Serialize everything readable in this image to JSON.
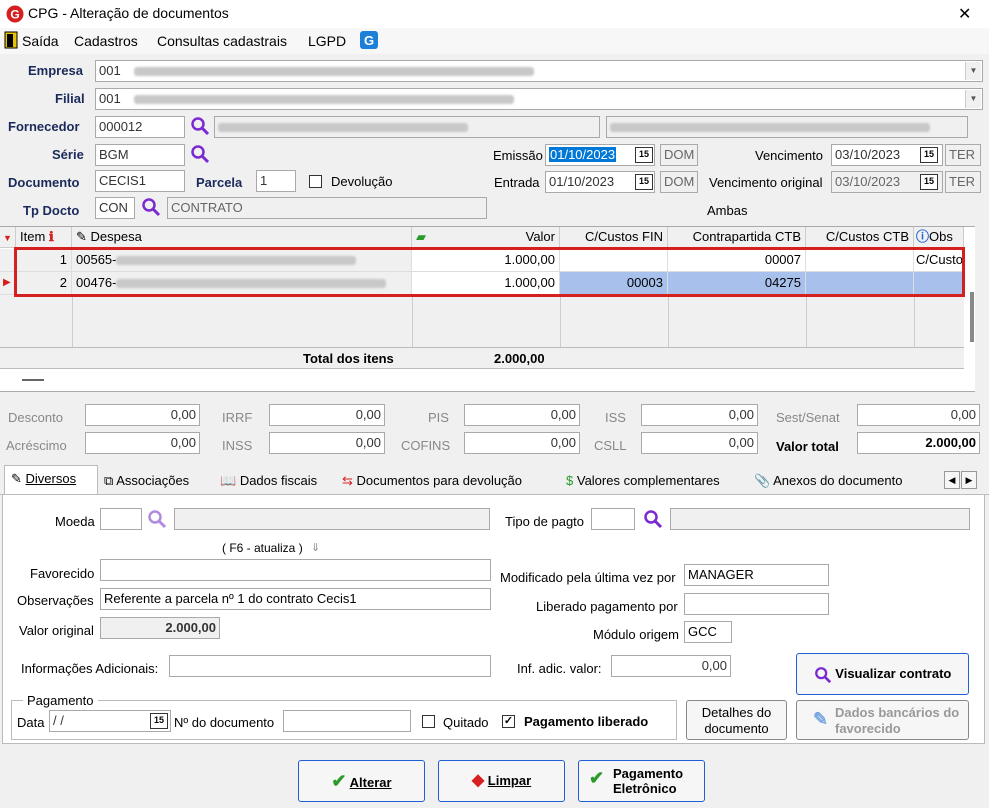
{
  "window": {
    "title": "CPG - Alteração de documentos",
    "close_glyph": "✕"
  },
  "menu": [
    "Saída",
    "Cadastros",
    "Consultas cadastrais",
    "LGPD"
  ],
  "header": {
    "empresa_label": "Empresa",
    "empresa_value": "001",
    "filial_label": "Filial",
    "filial_value": "001",
    "fornecedor_label": "Fornecedor",
    "fornecedor_value": "000012",
    "serie_label": "Série",
    "serie_value": "BGM",
    "documento_label": "Documento",
    "documento_value": "CECIS1",
    "parcela_label": "Parcela",
    "parcela_value": "1",
    "devolucao_label": "Devolução",
    "tpdocto_label": "Tp Docto",
    "tpdocto_value": "CON",
    "tpdocto_desc": "CONTRATO",
    "emissao_label": "Emissão",
    "emissao_value": "01/10/2023",
    "emissao_day": "DOM",
    "entrada_label": "Entrada",
    "entrada_value": "01/10/2023",
    "entrada_day": "DOM",
    "vencimento_label": "Vencimento",
    "vencimento_value": "03/10/2023",
    "vencimento_day": "TER",
    "vencorig_label": "Vencimento original",
    "vencorig_value": "03/10/2023",
    "vencorig_day": "TER",
    "ambas": "Ambas"
  },
  "grid": {
    "headers": {
      "item": "Item",
      "despesa": "Despesa",
      "valor": "Valor",
      "ccfin": "C/Custos FIN",
      "contrapartida": "Contrapartida CTB",
      "ccctb": "C/Custos CTB",
      "obs": "Obs"
    },
    "rows": [
      {
        "item": "1",
        "despesa": "00565-",
        "valor": "1.000,00",
        "ccfin": "",
        "contrapartida": "00007",
        "ccctb": "",
        "obs": "C/Custo"
      },
      {
        "item": "2",
        "despesa": "00476-",
        "valor": "1.000,00",
        "ccfin": "00003",
        "contrapartida": "04275",
        "ccctb": "",
        "obs": ""
      }
    ],
    "total_label": "Total dos itens",
    "total_value": "2.000,00"
  },
  "totals": {
    "desconto_label": "Desconto",
    "desconto": "0,00",
    "irrf_label": "IRRF",
    "irrf": "0,00",
    "pis_label": "PIS",
    "pis": "0,00",
    "iss_label": "ISS",
    "iss": "0,00",
    "sest_label": "Sest/Senat",
    "sest": "0,00",
    "acrescimo_label": "Acréscimo",
    "acrescimo": "0,00",
    "inss_label": "INSS",
    "inss": "0,00",
    "cofins_label": "COFINS",
    "cofins": "0,00",
    "csll_label": "CSLL",
    "csll": "0,00",
    "valortotal_label": "Valor total",
    "valortotal": "2.000,00"
  },
  "tabs": [
    "Diversos",
    "Associações",
    "Dados fiscais",
    "Documentos para devolução",
    "Valores complementares",
    "Anexos do documento"
  ],
  "diversos": {
    "moeda_label": "Moeda",
    "moeda_value": "",
    "f6_hint": "( F6 - atualiza )",
    "tipopagto_label": "Tipo de pagto",
    "tipopagto_value": "",
    "favorecido_label": "Favorecido",
    "favorecido_value": "",
    "observacoes_label": "Observações",
    "observacoes_value": "Referente a parcela nº 1 do contrato Cecis1",
    "valororiginal_label": "Valor original",
    "valororiginal_value": "2.000,00",
    "infoadic_label": "Informações Adicionais:",
    "infoadic_value": "",
    "modificado_label": "Modificado pela última vez por",
    "modificado_value": "MANAGER",
    "liberado_label": "Liberado pagamento por",
    "liberado_value": "",
    "modulo_label": "Módulo origem",
    "modulo_value": "GCC",
    "infadicvalor_label": "Inf. adic. valor:",
    "infadicvalor_value": "0,00",
    "visualizar_label": "Visualizar contrato",
    "pagamento_group": "Pagamento",
    "data_label": "Data",
    "data_value": " / /",
    "ndoc_label": "Nº do documento",
    "ndoc_value": "",
    "quitado_label": "Quitado",
    "pagliberado_label": "Pagamento liberado",
    "detalhes_label": "Detalhes do documento",
    "dadosbancarios_label": "Dados bancários do favorecido"
  },
  "footer": {
    "alterar": "Alterar",
    "limpar": "Limpar",
    "pagamento": "Pagamento Eletrônico"
  },
  "colors": {
    "accent": "#1a2a5a",
    "highlight": "#a8c0ec",
    "selection": "#0078d7",
    "red": "#d62020",
    "green": "#2a9a2a",
    "purple": "#7a2ad0"
  }
}
